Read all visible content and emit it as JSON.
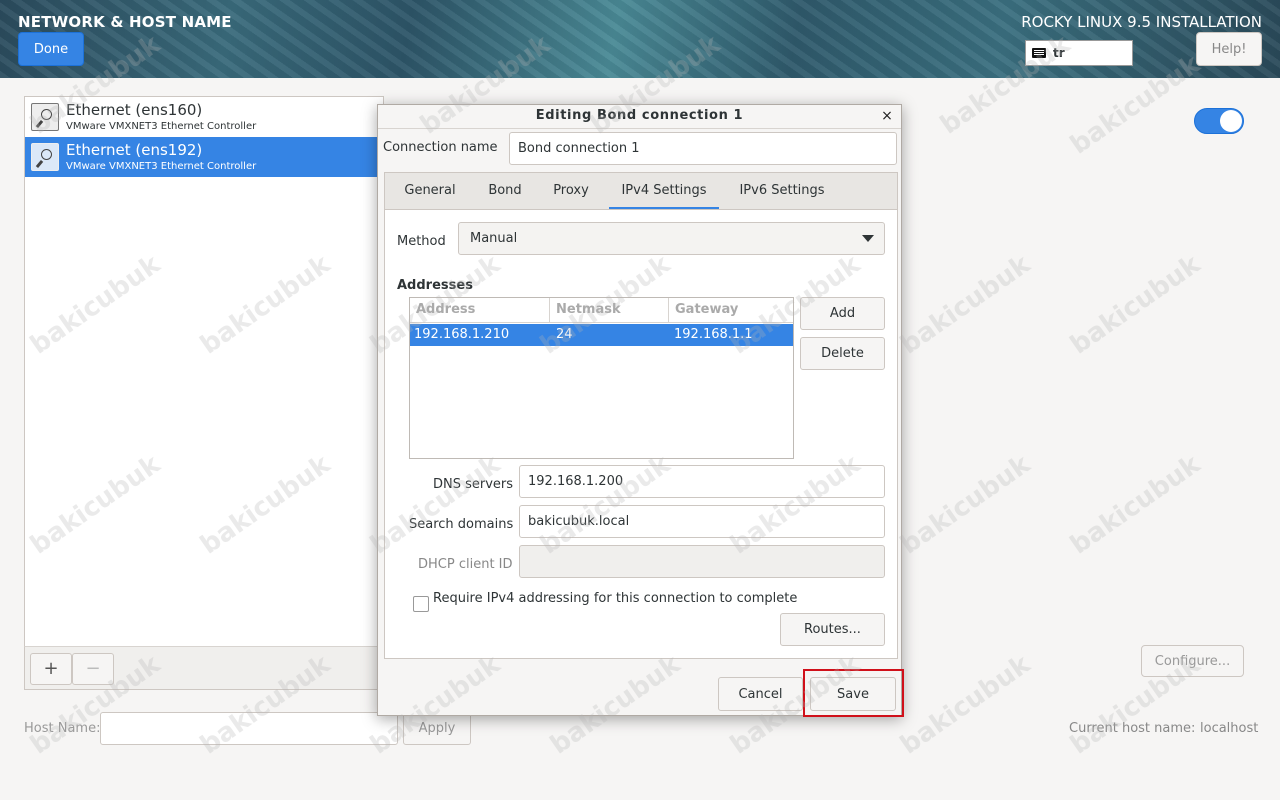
{
  "header": {
    "title": "NETWORK & HOST NAME",
    "done_label": "Done",
    "install_title": "ROCKY LINUX 9.5 INSTALLATION",
    "keyboard_layout": "tr",
    "help_label": "Help!"
  },
  "devices": [
    {
      "name": "Ethernet (ens160)",
      "description": "VMware VMXNET3 Ethernet Controller",
      "selected": false
    },
    {
      "name": "Ethernet (ens192)",
      "description": "VMware VMXNET3 Ethernet Controller",
      "selected": true
    }
  ],
  "list_toolbar": {
    "add_label": "+",
    "remove_label": "−"
  },
  "right_panel": {
    "toggle_on": true,
    "configure_label": "Configure..."
  },
  "host": {
    "label": "Host Name:",
    "value": "",
    "apply_label": "Apply",
    "current_label": "Current host name:",
    "current_value": "localhost"
  },
  "dialog": {
    "title": "Editing Bond connection 1",
    "close_glyph": "×",
    "connection_name_label": "Connection name",
    "connection_name_value": "Bond connection 1",
    "tabs": [
      {
        "label": "General",
        "active": false
      },
      {
        "label": "Bond",
        "active": false
      },
      {
        "label": "Proxy",
        "active": false
      },
      {
        "label": "IPv4 Settings",
        "active": true
      },
      {
        "label": "IPv6 Settings",
        "active": false
      }
    ],
    "method_label": "Method",
    "method_value": "Manual",
    "addresses_label": "Addresses",
    "address_columns": [
      "Address",
      "Netmask",
      "Gateway"
    ],
    "address_rows": [
      {
        "address": "192.168.1.210",
        "netmask": "24",
        "gateway": "192.168.1.1"
      }
    ],
    "add_label": "Add",
    "delete_label": "Delete",
    "dns_label": "DNS servers",
    "dns_value": "192.168.1.200",
    "search_label": "Search domains",
    "search_value": "bakicubuk.local",
    "dhcp_label": "DHCP client ID",
    "dhcp_value": "",
    "require_label": "Require IPv4 addressing for this connection to complete",
    "require_checked": false,
    "routes_label": "Routes...",
    "cancel_label": "Cancel",
    "save_label": "Save"
  },
  "watermark_text": "bakicubuk",
  "colors": {
    "accent": "#3584e4",
    "highlight": "#d0101a"
  }
}
